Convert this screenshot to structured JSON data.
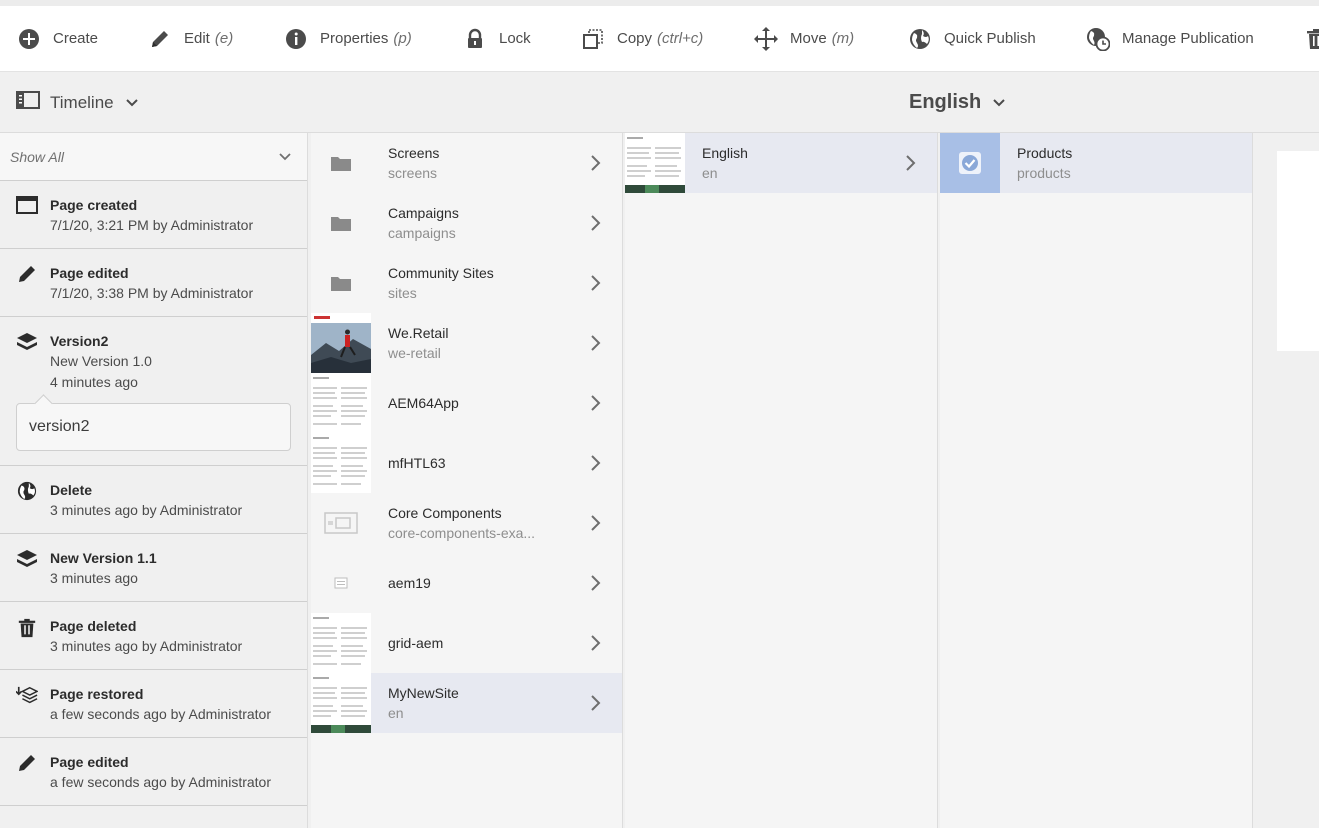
{
  "actionbar": {
    "create": "Create",
    "edit": "Edit",
    "edit_hint": "(e)",
    "properties": "Properties",
    "properties_hint": "(p)",
    "lock": "Lock",
    "copy": "Copy",
    "copy_hint": "(ctrl+c)",
    "move": "Move",
    "move_hint": "(m)",
    "quick_publish": "Quick Publish",
    "manage_publication": "Manage Publication"
  },
  "rail_switch": {
    "label": "Timeline"
  },
  "breadcrumb": {
    "label": "English"
  },
  "timeline": {
    "filter": "Show All",
    "events": [
      {
        "title": "Page created",
        "sub": "7/1/20, 3:21 PM by Administrator"
      },
      {
        "title": "Page edited",
        "sub": "7/1/20, 3:38 PM by Administrator"
      },
      {
        "title": "Version2",
        "sub": "New Version 1.0",
        "sub2": "4 minutes ago",
        "comment": "version2"
      },
      {
        "title": "Delete",
        "sub": "3 minutes ago by Administrator"
      },
      {
        "title": "New Version 1.1",
        "sub": "3 minutes ago"
      },
      {
        "title": "Page deleted",
        "sub": "3 minutes ago by Administrator"
      },
      {
        "title": "Page restored",
        "sub": "a few seconds ago by Administrator"
      },
      {
        "title": "Page edited",
        "sub": "a few seconds ago by Administrator"
      }
    ]
  },
  "column1": [
    {
      "title": "Screens",
      "name": "screens"
    },
    {
      "title": "Campaigns",
      "name": "campaigns"
    },
    {
      "title": "Community Sites",
      "name": "sites"
    },
    {
      "title": "We.Retail",
      "name": "we-retail"
    },
    {
      "title": "AEM64App",
      "name": ""
    },
    {
      "title": "mfHTL63",
      "name": ""
    },
    {
      "title": "Core Components",
      "name": "core-components-exa..."
    },
    {
      "title": "aem19",
      "name": ""
    },
    {
      "title": "grid-aem",
      "name": ""
    },
    {
      "title": "MyNewSite",
      "name": "en"
    }
  ],
  "column2": [
    {
      "title": "English",
      "name": "en"
    }
  ],
  "column3": [
    {
      "title": "Products",
      "name": "products"
    }
  ]
}
